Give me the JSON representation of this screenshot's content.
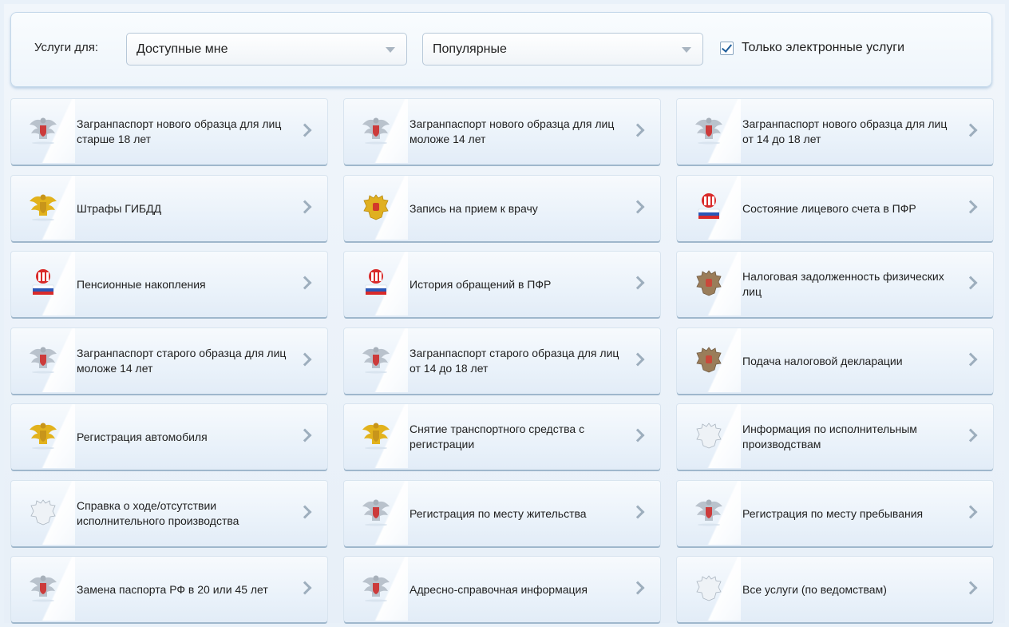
{
  "filters": {
    "label": "Услуги для:",
    "audience_select": {
      "value": "Доступные мне"
    },
    "category_select": {
      "value": "Популярные"
    },
    "electronic_only": {
      "label": "Только электронные услуги",
      "checked": true
    }
  },
  "services": [
    {
      "title": "Загранпаспорт нового образца для лиц старше 18 лет",
      "icon": "mvd-eagle-gray-icon"
    },
    {
      "title": "Загранпаспорт нового образца для лиц моложе 14 лет",
      "icon": "mvd-eagle-gray-icon"
    },
    {
      "title": "Загранпаспорт нового образца для лиц от 14 до 18 лет",
      "icon": "mvd-eagle-gray-icon"
    },
    {
      "title": "Штрафы ГИБДД",
      "icon": "mvd-eagle-gold-icon"
    },
    {
      "title": "Запись на прием к врачу",
      "icon": "russian-coat-of-arms-icon"
    },
    {
      "title": "Состояние лицевого счета в ПФР",
      "icon": "pfr-logo-icon"
    },
    {
      "title": "Пенсионные накопления",
      "icon": "pfr-logo-icon"
    },
    {
      "title": "История обращений в ПФР",
      "icon": "pfr-logo-icon"
    },
    {
      "title": "Налоговая задолженность физических лиц",
      "icon": "fns-eagle-icon"
    },
    {
      "title": "Загранпаспорт старого образца для лиц моложе 14 лет",
      "icon": "mvd-eagle-gray-icon"
    },
    {
      "title": "Загранпаспорт старого образца для лиц от 14 до 18 лет",
      "icon": "mvd-eagle-gray-icon"
    },
    {
      "title": "Подача налоговой декларации",
      "icon": "fns-eagle-icon"
    },
    {
      "title": "Регистрация автомобиля",
      "icon": "mvd-eagle-gold-icon"
    },
    {
      "title": "Снятие транспортного средства с регистрации",
      "icon": "mvd-eagle-gold-icon"
    },
    {
      "title": "Информация по исполнительным производствам",
      "icon": "fssp-eagle-icon"
    },
    {
      "title": "Справка о ходе/отсутствии исполнительного производства",
      "icon": "fssp-eagle-icon"
    },
    {
      "title": "Регистрация по месту жительства",
      "icon": "mvd-eagle-gray-icon"
    },
    {
      "title": "Регистрация по месту пребывания",
      "icon": "mvd-eagle-gray-icon"
    },
    {
      "title": "Замена паспорта РФ в 20 или 45 лет",
      "icon": "mvd-eagle-gray-icon"
    },
    {
      "title": "Адресно-справочная информация",
      "icon": "mvd-eagle-gray-icon"
    },
    {
      "title": "Все услуги (по ведомствам)",
      "icon": "fssp-eagle-icon"
    }
  ]
}
